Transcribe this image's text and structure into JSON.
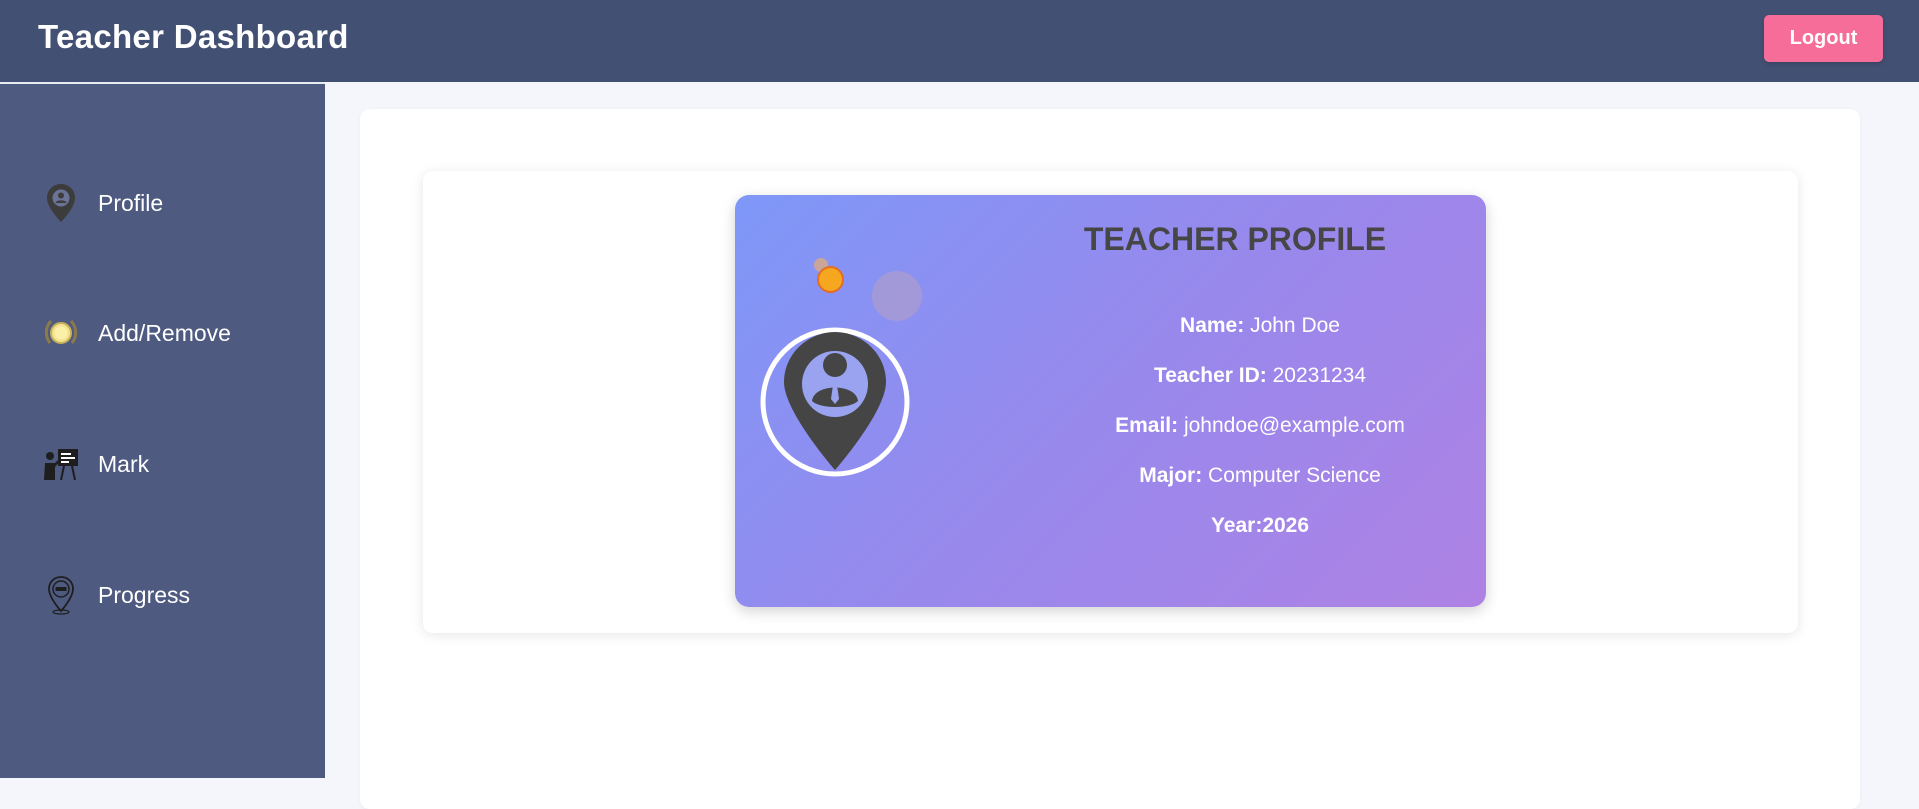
{
  "header": {
    "title": "Teacher Dashboard",
    "logout_label": "Logout"
  },
  "sidebar": {
    "items": [
      {
        "label": "Profile",
        "icon": "location-pin-icon"
      },
      {
        "label": "Add/Remove",
        "icon": "laurel-medal-icon"
      },
      {
        "label": "Mark",
        "icon": "teacher-board-icon"
      },
      {
        "label": "Progress",
        "icon": "job-pin-icon"
      }
    ]
  },
  "profile": {
    "title": "TEACHER PROFILE",
    "name_label": "Name:",
    "name_value": " John Doe",
    "id_label": "Teacher ID:",
    "id_value": " 20231234",
    "email_label": "Email:",
    "email_value": " johndoe@example.com",
    "major_label": "Major:",
    "major_value": " Computer Science",
    "year_label": "Year:2026"
  },
  "colors": {
    "header_bg": "#425073",
    "sidebar_bg": "#4e5a80",
    "logout_bg": "#f56d98",
    "card_gradient_start": "#7e98f8",
    "card_gradient_end": "#ae82e4",
    "title_text": "#464646"
  }
}
